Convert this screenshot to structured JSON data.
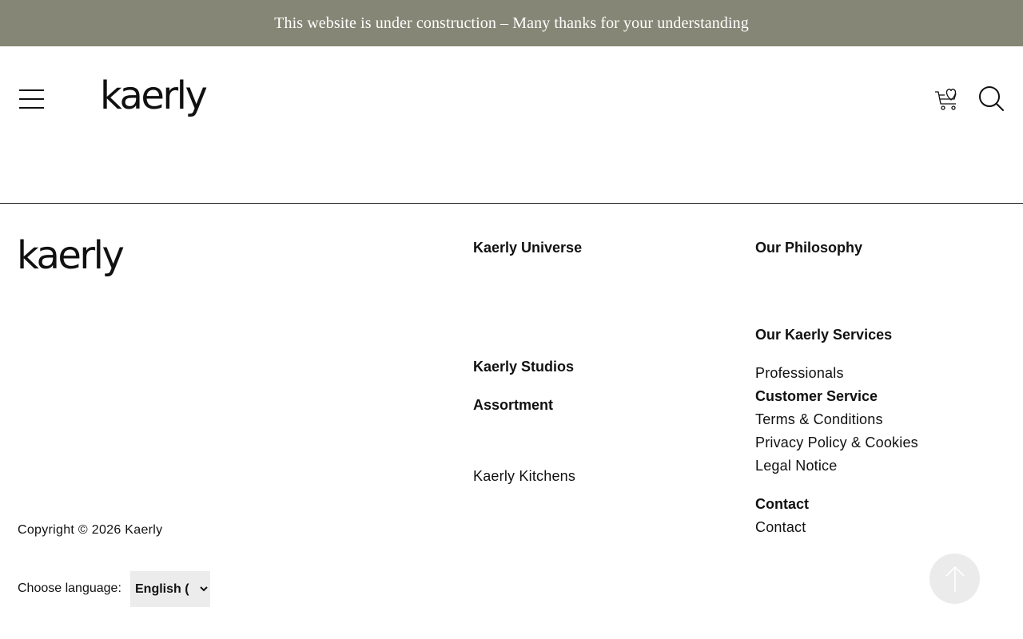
{
  "banner": {
    "text": "This website is under construction – Many thanks for your understanding"
  },
  "header": {
    "logo": "kaerly",
    "icons": {
      "menu": "hamburger-menu-icon",
      "cart": "cart-heart-icon",
      "search": "search-icon"
    }
  },
  "footer": {
    "logo": "kaerly",
    "universe": {
      "heading": "Kaerly Universe",
      "studios": "Kaerly Studios",
      "assortment": "Assortment",
      "kitchens": "Kaerly Kitchens"
    },
    "philosophy": {
      "heading": "Our Philosophy",
      "services_heading": "Our Kaerly Services",
      "professionals": "Professionals",
      "customer_service_heading": "Customer Service",
      "terms": "Terms & Conditions",
      "privacy": "Privacy Policy & Cookies",
      "legal": "Legal Notice",
      "contact_heading": "Contact",
      "contact": "Contact"
    },
    "copyright": "Copyright © 2026 Kaerly",
    "language": {
      "label": "Choose language:",
      "selected": "English ("
    }
  },
  "colors": {
    "banner_bg": "#858675",
    "banner_text": "#ffffff",
    "to_top_bg": "#ebebeb"
  }
}
